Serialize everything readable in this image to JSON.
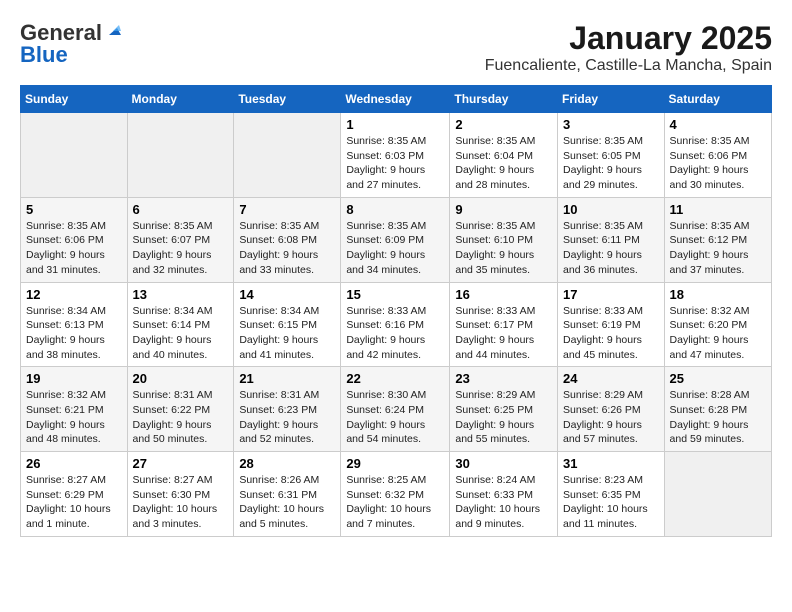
{
  "logo": {
    "general": "General",
    "blue": "Blue"
  },
  "header": {
    "title": "January 2025",
    "location": "Fuencaliente, Castille-La Mancha, Spain"
  },
  "weekdays": [
    "Sunday",
    "Monday",
    "Tuesday",
    "Wednesday",
    "Thursday",
    "Friday",
    "Saturday"
  ],
  "weeks": [
    [
      {
        "day": "",
        "info": ""
      },
      {
        "day": "",
        "info": ""
      },
      {
        "day": "",
        "info": ""
      },
      {
        "day": "1",
        "info": "Sunrise: 8:35 AM\nSunset: 6:03 PM\nDaylight: 9 hours\nand 27 minutes."
      },
      {
        "day": "2",
        "info": "Sunrise: 8:35 AM\nSunset: 6:04 PM\nDaylight: 9 hours\nand 28 minutes."
      },
      {
        "day": "3",
        "info": "Sunrise: 8:35 AM\nSunset: 6:05 PM\nDaylight: 9 hours\nand 29 minutes."
      },
      {
        "day": "4",
        "info": "Sunrise: 8:35 AM\nSunset: 6:06 PM\nDaylight: 9 hours\nand 30 minutes."
      }
    ],
    [
      {
        "day": "5",
        "info": "Sunrise: 8:35 AM\nSunset: 6:06 PM\nDaylight: 9 hours\nand 31 minutes."
      },
      {
        "day": "6",
        "info": "Sunrise: 8:35 AM\nSunset: 6:07 PM\nDaylight: 9 hours\nand 32 minutes."
      },
      {
        "day": "7",
        "info": "Sunrise: 8:35 AM\nSunset: 6:08 PM\nDaylight: 9 hours\nand 33 minutes."
      },
      {
        "day": "8",
        "info": "Sunrise: 8:35 AM\nSunset: 6:09 PM\nDaylight: 9 hours\nand 34 minutes."
      },
      {
        "day": "9",
        "info": "Sunrise: 8:35 AM\nSunset: 6:10 PM\nDaylight: 9 hours\nand 35 minutes."
      },
      {
        "day": "10",
        "info": "Sunrise: 8:35 AM\nSunset: 6:11 PM\nDaylight: 9 hours\nand 36 minutes."
      },
      {
        "day": "11",
        "info": "Sunrise: 8:35 AM\nSunset: 6:12 PM\nDaylight: 9 hours\nand 37 minutes."
      }
    ],
    [
      {
        "day": "12",
        "info": "Sunrise: 8:34 AM\nSunset: 6:13 PM\nDaylight: 9 hours\nand 38 minutes."
      },
      {
        "day": "13",
        "info": "Sunrise: 8:34 AM\nSunset: 6:14 PM\nDaylight: 9 hours\nand 40 minutes."
      },
      {
        "day": "14",
        "info": "Sunrise: 8:34 AM\nSunset: 6:15 PM\nDaylight: 9 hours\nand 41 minutes."
      },
      {
        "day": "15",
        "info": "Sunrise: 8:33 AM\nSunset: 6:16 PM\nDaylight: 9 hours\nand 42 minutes."
      },
      {
        "day": "16",
        "info": "Sunrise: 8:33 AM\nSunset: 6:17 PM\nDaylight: 9 hours\nand 44 minutes."
      },
      {
        "day": "17",
        "info": "Sunrise: 8:33 AM\nSunset: 6:19 PM\nDaylight: 9 hours\nand 45 minutes."
      },
      {
        "day": "18",
        "info": "Sunrise: 8:32 AM\nSunset: 6:20 PM\nDaylight: 9 hours\nand 47 minutes."
      }
    ],
    [
      {
        "day": "19",
        "info": "Sunrise: 8:32 AM\nSunset: 6:21 PM\nDaylight: 9 hours\nand 48 minutes."
      },
      {
        "day": "20",
        "info": "Sunrise: 8:31 AM\nSunset: 6:22 PM\nDaylight: 9 hours\nand 50 minutes."
      },
      {
        "day": "21",
        "info": "Sunrise: 8:31 AM\nSunset: 6:23 PM\nDaylight: 9 hours\nand 52 minutes."
      },
      {
        "day": "22",
        "info": "Sunrise: 8:30 AM\nSunset: 6:24 PM\nDaylight: 9 hours\nand 54 minutes."
      },
      {
        "day": "23",
        "info": "Sunrise: 8:29 AM\nSunset: 6:25 PM\nDaylight: 9 hours\nand 55 minutes."
      },
      {
        "day": "24",
        "info": "Sunrise: 8:29 AM\nSunset: 6:26 PM\nDaylight: 9 hours\nand 57 minutes."
      },
      {
        "day": "25",
        "info": "Sunrise: 8:28 AM\nSunset: 6:28 PM\nDaylight: 9 hours\nand 59 minutes."
      }
    ],
    [
      {
        "day": "26",
        "info": "Sunrise: 8:27 AM\nSunset: 6:29 PM\nDaylight: 10 hours\nand 1 minute."
      },
      {
        "day": "27",
        "info": "Sunrise: 8:27 AM\nSunset: 6:30 PM\nDaylight: 10 hours\nand 3 minutes."
      },
      {
        "day": "28",
        "info": "Sunrise: 8:26 AM\nSunset: 6:31 PM\nDaylight: 10 hours\nand 5 minutes."
      },
      {
        "day": "29",
        "info": "Sunrise: 8:25 AM\nSunset: 6:32 PM\nDaylight: 10 hours\nand 7 minutes."
      },
      {
        "day": "30",
        "info": "Sunrise: 8:24 AM\nSunset: 6:33 PM\nDaylight: 10 hours\nand 9 minutes."
      },
      {
        "day": "31",
        "info": "Sunrise: 8:23 AM\nSunset: 6:35 PM\nDaylight: 10 hours\nand 11 minutes."
      },
      {
        "day": "",
        "info": ""
      }
    ]
  ]
}
